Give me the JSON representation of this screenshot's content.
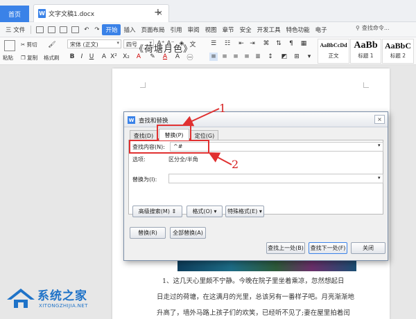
{
  "titlebar": {
    "home_tab": "首页",
    "doc_tab": "文字文稿1.docx",
    "doc_icon_letter": "W",
    "doc_close": "×",
    "add_tab": "+"
  },
  "menubar": {
    "file_label": "三 文件",
    "items": [
      "开始",
      "插入",
      "页面布局",
      "引用",
      "审阅",
      "视图",
      "章节",
      "安全",
      "开发工具",
      "特色功能",
      "电子"
    ],
    "active_item": "开始",
    "search_label": "查找命令..."
  },
  "ribbon": {
    "paste": "粘贴",
    "cut": "剪切",
    "copy": "复制",
    "format_painter": "格式刷",
    "font_name": "宋体 (正文)",
    "font_size": "四号",
    "styles": [
      {
        "preview": "AaBbCcDd",
        "label": "正文"
      },
      {
        "preview": "AaBb",
        "label": "标题 1"
      },
      {
        "preview": "AaBbC",
        "label": "标题 2"
      }
    ]
  },
  "document": {
    "title": "《荷塘月色》",
    "paragraph_lines": [
      "1、这几天心里颇不宁静。今晚在院子里坐着乘凉，忽然想起日",
      "日走过的荷塘，在这满月的光里，总该另有一番样子吧。月亮渐渐地",
      "升高了，墙外马路上孩子们的欢笑，已经听不见了;妻在屋里拍着闰"
    ]
  },
  "dialog": {
    "icon_letter": "W",
    "title": "查找和替换",
    "close": "×",
    "tabs": [
      {
        "label": "查找(D)",
        "active": false
      },
      {
        "label": "替换(P)",
        "active": true
      },
      {
        "label": "定位(G)",
        "active": false
      }
    ],
    "find_label": "查找内容(N):",
    "find_value": "^#",
    "options_label": "选项:",
    "options_value": "区分全/半角",
    "replace_label": "替换为(I):",
    "replace_value": "",
    "dropdown_arrow": "▾",
    "advanced_search": "高级搜索(M) ⇕",
    "format": "格式(O) ▾",
    "special_format": "特殊格式(E) ▾",
    "replace_button": "替换(R)",
    "replace_all_button": "全部替换(A)",
    "find_prev_button": "查找上一处(B)",
    "find_next_button": "查找下一处(F)",
    "close_button": "关闭"
  },
  "annotations": {
    "num1": "1",
    "num2": "2",
    "color": "#e03030"
  },
  "watermark": {
    "name": "系统之家",
    "url": "XITONGZHIJIA.NET"
  }
}
